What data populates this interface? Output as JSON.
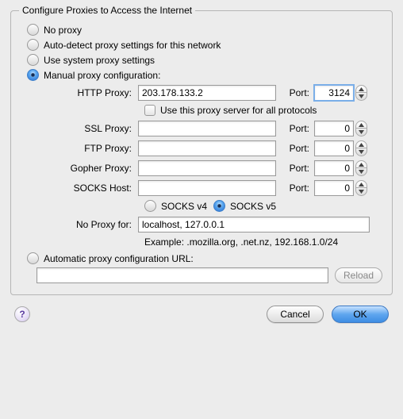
{
  "group_title": "Configure Proxies to Access the Internet",
  "radios": {
    "no_proxy": "No proxy",
    "auto_detect": "Auto-detect proxy settings for this network",
    "system": "Use system proxy settings",
    "manual": "Manual proxy configuration:",
    "pac": "Automatic proxy configuration URL:"
  },
  "fields": {
    "http": {
      "label": "HTTP Proxy:",
      "host": "203.178.133.2",
      "port": "3124"
    },
    "ssl": {
      "label": "SSL Proxy:",
      "host": "",
      "port": "0"
    },
    "ftp": {
      "label": "FTP Proxy:",
      "host": "",
      "port": "0"
    },
    "gopher": {
      "label": "Gopher Proxy:",
      "host": "",
      "port": "0"
    },
    "socks": {
      "label": "SOCKS Host:",
      "host": "",
      "port": "0"
    },
    "port_label": "Port:"
  },
  "all_protocols": "Use this proxy server for all protocols",
  "socks_versions": {
    "v4": "SOCKS v4",
    "v5": "SOCKS v5"
  },
  "noproxy": {
    "label": "No Proxy for:",
    "value": "localhost, 127.0.0.1",
    "example": "Example: .mozilla.org, .net.nz, 192.168.1.0/24"
  },
  "pac_url": "",
  "buttons": {
    "reload": "Reload",
    "help": "?",
    "cancel": "Cancel",
    "ok": "OK"
  }
}
